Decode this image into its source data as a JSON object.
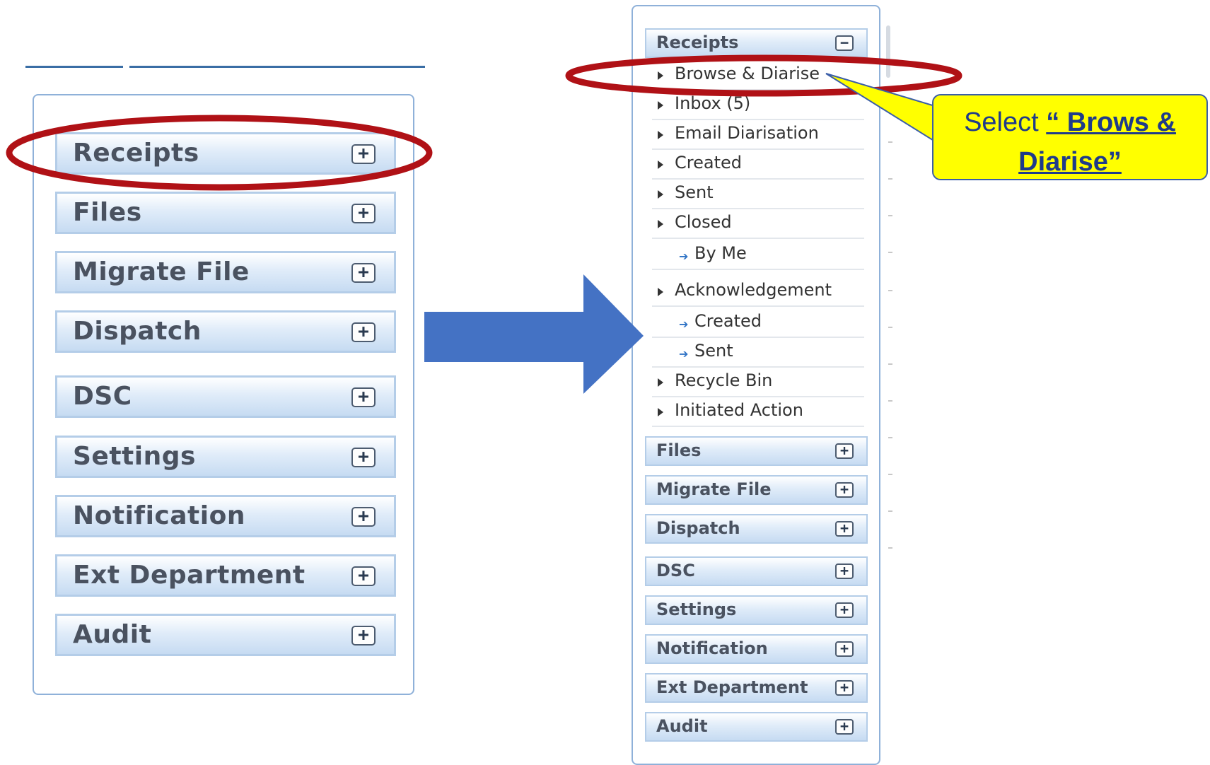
{
  "left_menu": {
    "items": [
      {
        "label": "Receipts",
        "toggle": "+"
      },
      {
        "label": "Files",
        "toggle": "+"
      },
      {
        "label": "Migrate File",
        "toggle": "+"
      },
      {
        "label": "Dispatch",
        "toggle": "+"
      },
      {
        "label": "DSC",
        "toggle": "+"
      },
      {
        "label": "Settings",
        "toggle": "+"
      },
      {
        "label": "Notification",
        "toggle": "+"
      },
      {
        "label": "Ext Department",
        "toggle": "+"
      },
      {
        "label": "Audit",
        "toggle": "+"
      }
    ]
  },
  "right_menu": {
    "receipts": {
      "label": "Receipts",
      "toggle": "−"
    },
    "submenu": [
      {
        "label": "Browse & Diarise"
      },
      {
        "label": "Inbox (5)"
      },
      {
        "label": "Email Diarisation"
      },
      {
        "label": "Created"
      },
      {
        "label": "Sent"
      },
      {
        "label": "Closed"
      },
      {
        "label": "By Me"
      },
      {
        "label": "Acknowledgement"
      },
      {
        "label": "Created"
      },
      {
        "label": "Sent"
      },
      {
        "label": "Recycle Bin"
      },
      {
        "label": "Initiated Action"
      }
    ],
    "items": [
      {
        "label": "Files",
        "toggle": "+"
      },
      {
        "label": "Migrate File",
        "toggle": "+"
      },
      {
        "label": "Dispatch",
        "toggle": "+"
      },
      {
        "label": "DSC",
        "toggle": "+"
      },
      {
        "label": "Settings",
        "toggle": "+"
      },
      {
        "label": "Notification",
        "toggle": "+"
      },
      {
        "label": "Ext Department",
        "toggle": "+"
      },
      {
        "label": "Audit",
        "toggle": "+"
      }
    ]
  },
  "callout": {
    "prefix": "Select ",
    "emphasis_line1": "“ Brows &",
    "emphasis_line2": "Diarise”"
  },
  "colors": {
    "arrow": "#4472c4",
    "highlight_ellipse": "#b01116",
    "callout_fill": "#ffff00"
  }
}
